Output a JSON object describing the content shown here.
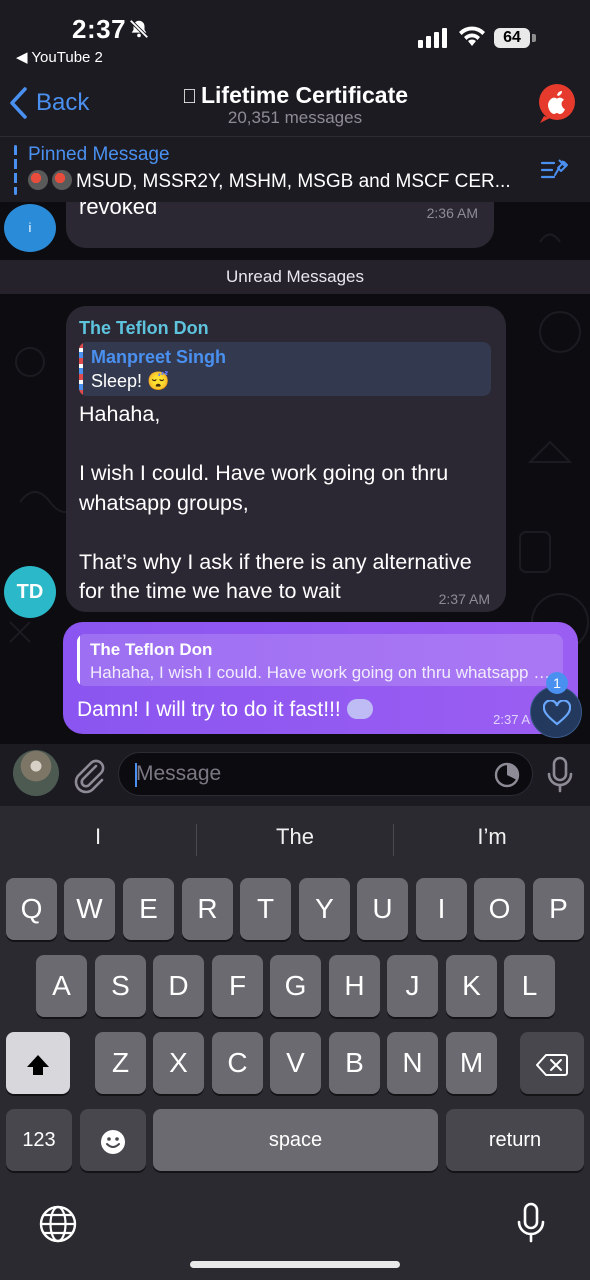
{
  "status_bar": {
    "time": "2:37",
    "back_app": "◀ YouTube 2",
    "battery": "64"
  },
  "header": {
    "back_label": "Back",
    "title_icon": "apple-logo-icon",
    "title": "Lifetime Certificate",
    "subtitle": "20,351 messages"
  },
  "pinned": {
    "label": "Pinned Message",
    "text": "MSUD, MSSR2Y, MSHM, MSGB and MSCF CER..."
  },
  "messages": {
    "top_fragment": {
      "text": "revoked",
      "time": "2:36 AM"
    },
    "unread_label": "Unread Messages",
    "incoming": {
      "sender": "The Teflon Don",
      "sender_initials": "TD",
      "reply_name": "Manpreet Singh",
      "reply_text": "Sleep! 😴",
      "body": "Hahaha,\n\nI wish I could. Have work going on thru whatsapp groups,\n\nThat’s why I ask if there is any alternative for the time we have to wait",
      "time": "2:37 AM"
    },
    "outgoing": {
      "reply_name": "The Teflon Don",
      "reply_text": "Hahaha, I wish I could. Have work going on thru whatsapp groups,",
      "body": "Damn! I will try to do it fast!!!",
      "time": "2:37 A",
      "reaction_count": "1"
    }
  },
  "input": {
    "placeholder": "Message"
  },
  "keyboard": {
    "suggestions": [
      "I",
      "The",
      "I’m"
    ],
    "row1": [
      "Q",
      "W",
      "E",
      "R",
      "T",
      "Y",
      "U",
      "I",
      "O",
      "P"
    ],
    "row2": [
      "A",
      "S",
      "D",
      "F",
      "G",
      "H",
      "J",
      "K",
      "L"
    ],
    "row3": [
      "Z",
      "X",
      "C",
      "V",
      "B",
      "N",
      "M"
    ],
    "numbers_label": "123",
    "space_label": "space",
    "return_label": "return"
  },
  "colors": {
    "accent_blue": "#4a90f0",
    "outgoing_bubble": "#9b5ef2",
    "incoming_bubble": "#2c2833",
    "sender_name": "#5ec4de"
  }
}
